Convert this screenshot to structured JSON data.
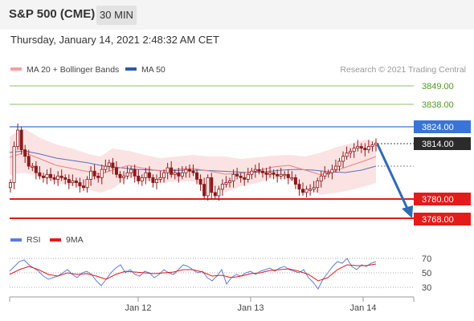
{
  "header": {
    "instrument": "S&P 500 (CME)",
    "timeframe": "30 MIN",
    "timestamp": "Thursday, January 14, 2021 2:48:32 AM CET"
  },
  "legend": {
    "ma_bollinger": "MA 20 + Bollinger Bands",
    "ma50": "MA 50",
    "credit": "Research © 2021 Trading Central"
  },
  "colors": {
    "bollinger": "#f5a0a0",
    "ma50": "#2e5e9e",
    "resistance_green": "#8cc26a",
    "blue_line": "#3b73d6",
    "support_red": "#e31b1b",
    "candles": "#8b1a1a",
    "rsi": "#5b7fd6",
    "rsi_ma": "#e31b1b",
    "arrow": "#2e6bb5"
  },
  "levels": [
    {
      "value": "3849.00",
      "style": "green-text"
    },
    {
      "value": "3838.00",
      "style": "green-text"
    },
    {
      "value": "3824.00",
      "style": "blue-tag"
    },
    {
      "value": "3814.00",
      "style": "dark-tag"
    },
    {
      "value": "3780.00",
      "style": "red-tag"
    },
    {
      "value": "3768.00",
      "style": "red-tag"
    }
  ],
  "rsi_panel": {
    "rsi_label": "RSI",
    "ma_label": "9MA",
    "levels": [
      "70",
      "50",
      "30"
    ]
  },
  "x_axis": {
    "labels": [
      "Jan 12",
      "Jan 13",
      "Jan 14"
    ]
  },
  "chart_data": {
    "type": "candlestick",
    "y_range": [
      3760,
      3852
    ],
    "close_series": [
      3790,
      3812,
      3822,
      3810,
      3806,
      3800,
      3800,
      3796,
      3794,
      3793,
      3795,
      3793,
      3792,
      3794,
      3793,
      3792,
      3790,
      3791,
      3790,
      3788,
      3787,
      3792,
      3797,
      3794,
      3793,
      3798,
      3800,
      3802,
      3799,
      3795,
      3793,
      3794,
      3796,
      3798,
      3794,
      3791,
      3793,
      3796,
      3793,
      3790,
      3792,
      3793,
      3796,
      3799,
      3795,
      3796,
      3794,
      3796,
      3798,
      3797,
      3796,
      3792,
      3789,
      3782,
      3793,
      3784,
      3782,
      3786,
      3789,
      3790,
      3791,
      3795,
      3794,
      3793,
      3792,
      3795,
      3797,
      3798,
      3797,
      3796,
      3795,
      3796,
      3795,
      3794,
      3795,
      3795,
      3793,
      3793,
      3789,
      3786,
      3784,
      3786,
      3786,
      3787,
      3791,
      3794,
      3796,
      3796,
      3798,
      3800,
      3803,
      3806,
      3808,
      3809,
      3811,
      3812,
      3811,
      3810,
      3812,
      3813,
      3814
    ],
    "trend": "bearish-arrow-toward-3768"
  }
}
